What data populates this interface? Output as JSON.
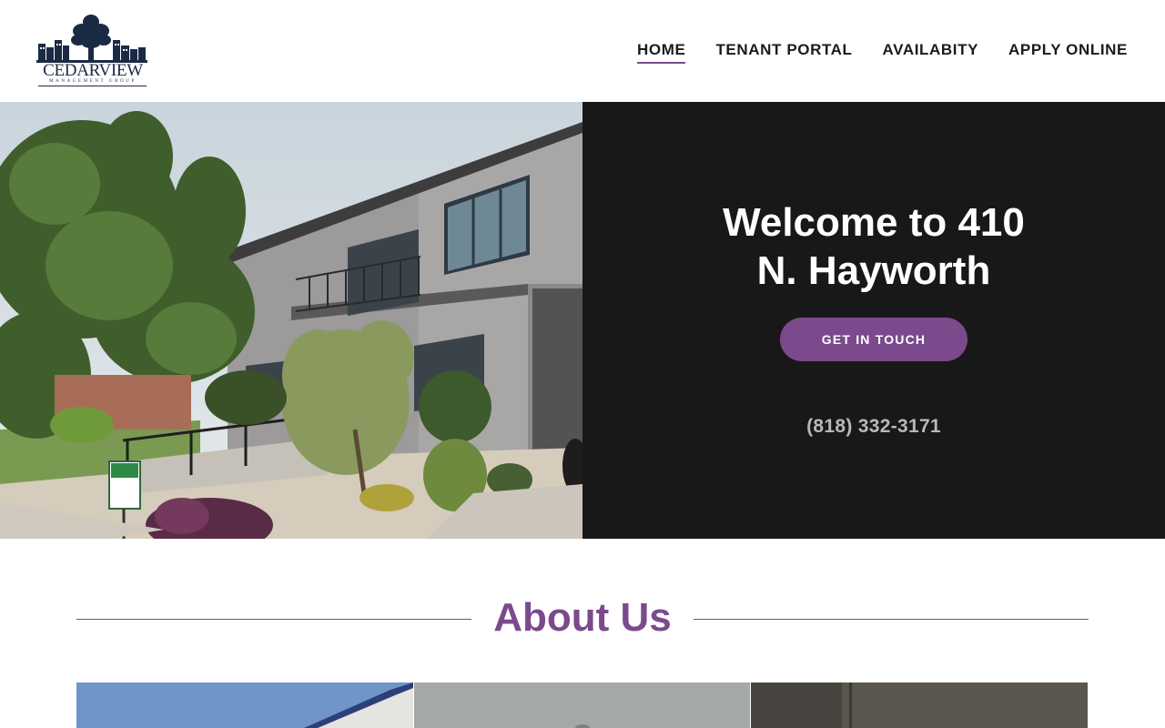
{
  "brand": {
    "name": "CEDARVIEW",
    "tagline": "MANAGEMENT GROUP",
    "color": "#1b2a44"
  },
  "nav": {
    "items": [
      {
        "label": "HOME",
        "active": true
      },
      {
        "label": "TENANT PORTAL",
        "active": false
      },
      {
        "label": "AVAILABITY",
        "active": false
      },
      {
        "label": "APPLY ONLINE",
        "active": false
      }
    ]
  },
  "hero": {
    "title_line1": "Welcome to 410",
    "title_line2": "N. Hayworth",
    "cta_label": "GET IN TOUCH",
    "phone": "(818) 332-3171",
    "photo_icon": "apartment-building-photo"
  },
  "about": {
    "heading": "About Us"
  },
  "colors": {
    "accent": "#7b4a8c",
    "hero_panel": "#191819",
    "text": "#1b1b1b"
  }
}
